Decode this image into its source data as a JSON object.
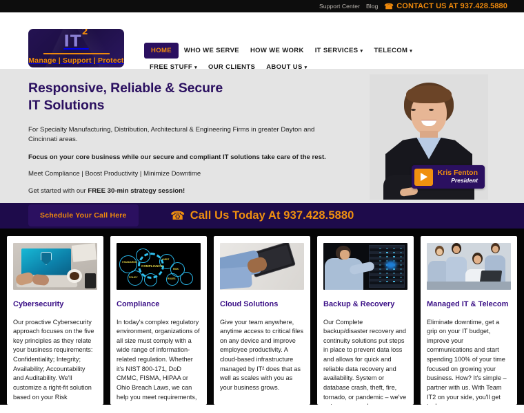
{
  "topbar": {
    "support_center": "Support Center",
    "blog": "Blog",
    "phone_icon": "phone-icon",
    "contact": "CONTACT US AT 937.428.5880"
  },
  "logo": {
    "mark": "IT",
    "superscript": "2",
    "tagline": "Manage | Support | Protect"
  },
  "nav": {
    "items": [
      {
        "label": "HOME",
        "active": true,
        "caret": ""
      },
      {
        "label": "WHO WE SERVE",
        "active": false,
        "caret": ""
      },
      {
        "label": "HOW WE WORK",
        "active": false,
        "caret": ""
      },
      {
        "label": "IT SERVICES",
        "active": false,
        "caret": "▾"
      },
      {
        "label": "TELECOM",
        "active": false,
        "caret": "▾"
      },
      {
        "label": "FREE STUFF",
        "active": false,
        "caret": "▾"
      },
      {
        "label": "OUR CLIENTS",
        "active": false,
        "caret": ""
      },
      {
        "label": "ABOUT US",
        "active": false,
        "caret": "▾"
      }
    ]
  },
  "hero": {
    "heading_line1": "Responsive, Reliable & Secure",
    "heading_line2": "IT Solutions",
    "lead": "For Specialty Manufacturing, Distribution, Architectural & Engineering Firms in greater Dayton and Cincinnati areas.",
    "bold_line": "Focus on your core business while our secure and compliant IT solutions take care of the rest.",
    "pipes_line": "Meet Compliance | Boost Productivity | Minimize Downtime",
    "getstarted_prefix": "Get started with our ",
    "getstarted_bold": "FREE 30-min strategy session!",
    "cta_label": "Schedule Your Call Here",
    "video": {
      "play_icon": "play-icon",
      "name": "Kris Fenton",
      "role": "President"
    }
  },
  "call_banner": {
    "phone_icon": "phone-icon",
    "text": "Call Us Today At 937.428.5880"
  },
  "cards": [
    {
      "image": "cybersecurity-laptop-image",
      "title": "Cybersecurity",
      "body": "Our proactive Cybersecurity approach focuses on the five key principles as they relate your business requirements: Confidentiality; Integrity; Availability; Accountability and Auditability. We'll customize a right-fit solution based on your Risk"
    },
    {
      "image": "compliance-diagram-image",
      "title": "Compliance",
      "body": "In today's complex regulatory environment, organizations of all size must comply with a wide range of information-related regulation. Whether it's NIST 800-171, DoD CMMC, FISMA, HIPAA or Ohio Breach Laws, we can help you meet requirements, pass your"
    },
    {
      "image": "cloud-tablet-image",
      "title": "Cloud Solutions",
      "body": "Give your team anywhere, anytime access to critical files on any device and improve employee productivity. A cloud-based infrastructure managed by IT² does that as well as scales with you as your business grows."
    },
    {
      "image": "backup-server-image",
      "title": "Backup & Recovery",
      "body": "Our Complete backup/disaster recovery and continuity solutions put steps in place to prevent data loss and allows for quick and reliable data recovery and availability. System or database crash, theft, fire, tornado, or pandemic – we've got you covered."
    },
    {
      "image": "managed-it-team-image",
      "title": "Managed IT & Telecom",
      "body": "Eliminate downtime, get a grip on your IT budget, improve your communications and start spending 100% of your time focused on growing your business. How? It's simple – partner with us. With Team IT2 on your side, you'll get tech"
    }
  ],
  "colors": {
    "brand_purple": "#2b1060",
    "brand_orange": "#f0900f",
    "title_purple": "#3a0f86",
    "topbar_black": "#0d0d0d",
    "hero_gray": "#e4e4e4",
    "cards_black": "#050505"
  },
  "compliance_labels": {
    "center": "COMPLIANCE",
    "nodes": [
      "STANDARDS",
      "REGULATIONS",
      "POLICY",
      "AUDIT",
      "RISK",
      "RULES",
      "LEGAL",
      "GUIDELINES"
    ]
  }
}
